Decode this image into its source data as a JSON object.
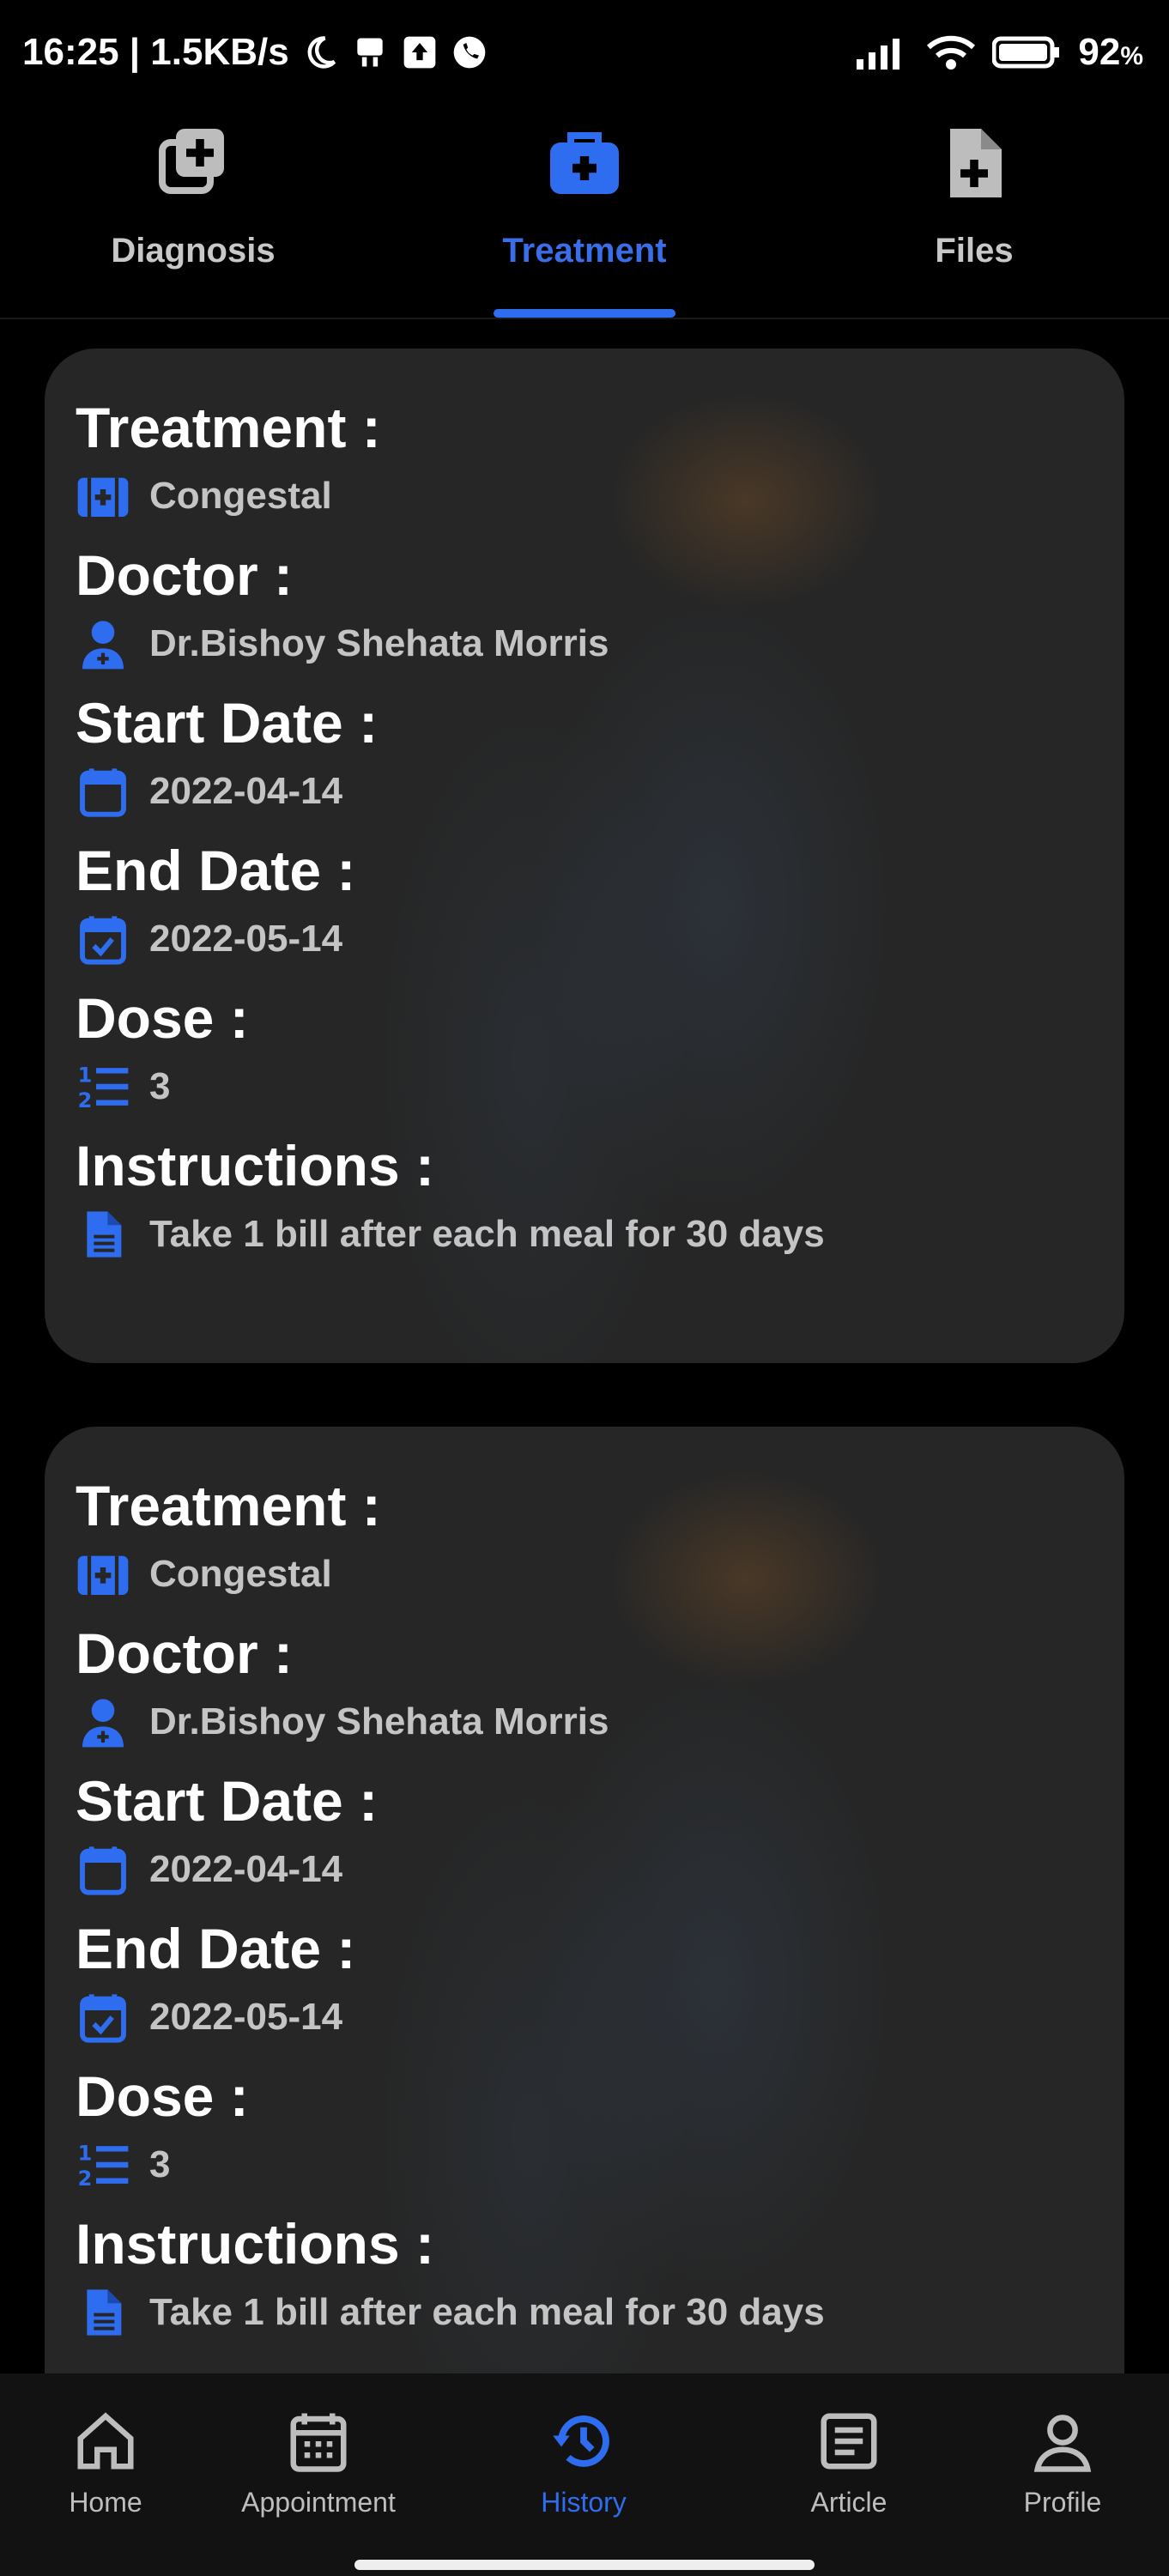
{
  "status_bar": {
    "time_speed": "16:25 | 1.5KB/s",
    "battery": "92",
    "battery_unit": "%"
  },
  "tabs": [
    {
      "label": "Diagnosis",
      "icon": "diagnosis-icon",
      "active": false
    },
    {
      "label": "Treatment",
      "icon": "briefcase-medical-icon",
      "active": true
    },
    {
      "label": "Files",
      "icon": "file-medical-icon",
      "active": false
    }
  ],
  "cards": [
    {
      "treatment_label": "Treatment :",
      "treatment": "Congestal",
      "doctor_label": "Doctor :",
      "doctor": "Dr.Bishoy Shehata Morris",
      "start_label": "Start Date :",
      "start_date": "2022-04-14",
      "end_label": "End Date :",
      "end_date": "2022-05-14",
      "dose_label": "Dose :",
      "dose": "3",
      "instructions_label": "Instructions :",
      "instructions": "Take 1 bill after each meal for 30 days"
    },
    {
      "treatment_label": "Treatment :",
      "treatment": "Congestal",
      "doctor_label": "Doctor :",
      "doctor": "Dr.Bishoy Shehata Morris",
      "start_label": "Start Date :",
      "start_date": "2022-04-14",
      "end_label": "End Date :",
      "end_date": "2022-05-14",
      "dose_label": "Dose :",
      "dose": "3",
      "instructions_label": "Instructions :",
      "instructions": "Take 1 bill after each meal for 30 days"
    }
  ],
  "bottom_nav": [
    {
      "label": "Home",
      "icon": "home-icon",
      "active": false
    },
    {
      "label": "Appointment",
      "icon": "calendar-icon",
      "active": false
    },
    {
      "label": "History",
      "icon": "history-icon",
      "active": true
    },
    {
      "label": "Article",
      "icon": "article-icon",
      "active": false
    },
    {
      "label": "Profile",
      "icon": "profile-icon",
      "active": false
    }
  ],
  "colors": {
    "accent": "#2f6df0",
    "card_bg": "#262626",
    "text_muted": "#c4c4c4"
  }
}
